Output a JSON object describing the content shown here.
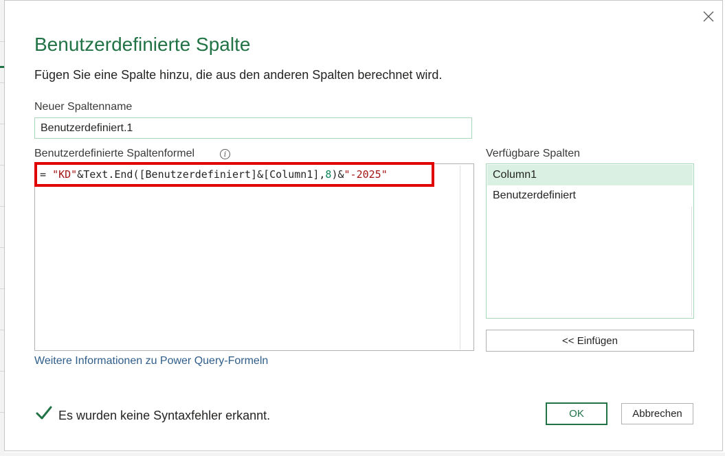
{
  "dialog": {
    "title": "Benutzerdefinierte Spalte",
    "subtitle": "Fügen Sie eine Spalte hinzu, die aus den anderen Spalten berechnet wird.",
    "close_icon": "close-icon"
  },
  "column_name": {
    "label": "Neuer Spaltenname",
    "value": "Benutzerdefiniert.1"
  },
  "formula": {
    "label": "Benutzerdefinierte Spaltenformel",
    "info_icon": "info-icon",
    "info_glyph": "i",
    "tokens": [
      {
        "text": "= ",
        "kind": "op"
      },
      {
        "text": "\"KD\"",
        "kind": "str"
      },
      {
        "text": "&Text.End([Benutzerdefiniert]&[Column1],",
        "kind": "op"
      },
      {
        "text": "8",
        "kind": "num"
      },
      {
        "text": ")&",
        "kind": "op"
      },
      {
        "text": "\"-2025\"",
        "kind": "str"
      }
    ]
  },
  "available_columns": {
    "label": "Verfügbare Spalten",
    "items": [
      {
        "label": "Column1",
        "selected": true
      },
      {
        "label": "Benutzerdefiniert",
        "selected": false
      }
    ],
    "insert_label": "<< Einfügen"
  },
  "more_info_link": "Weitere Informationen zu Power Query-Formeln",
  "status": {
    "text": "Es wurden keine Syntaxfehler erkannt.",
    "icon": "check-icon"
  },
  "buttons": {
    "ok": "OK",
    "cancel": "Abbrechen"
  },
  "colors": {
    "accent": "#217346",
    "highlight_box": "#e00000",
    "string_token": "#a31515",
    "number_token": "#098658",
    "link": "#2f5d8a"
  }
}
